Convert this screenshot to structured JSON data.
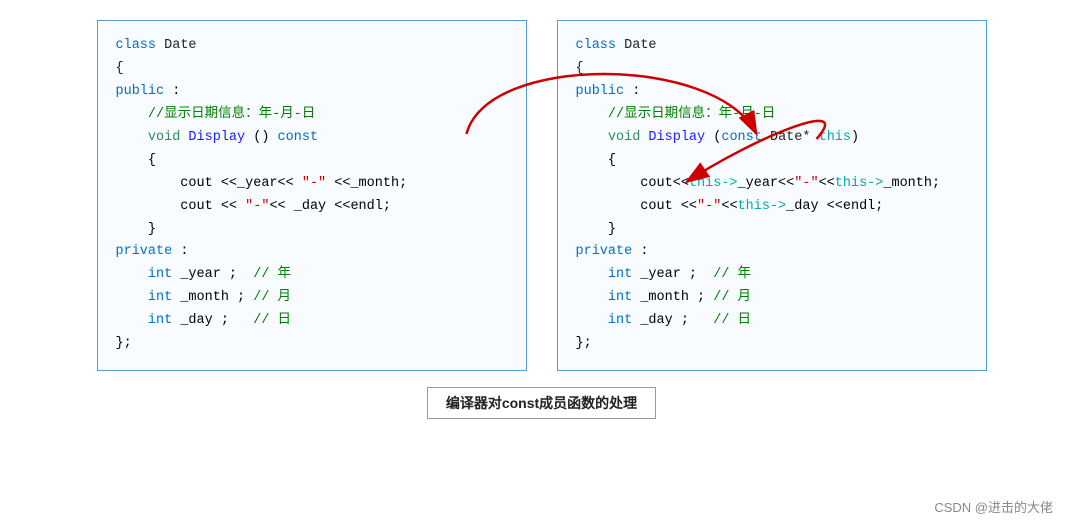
{
  "left_panel": {
    "lines": [
      {
        "id": "l1",
        "content": "class Date",
        "type": "normal"
      },
      {
        "id": "l2",
        "content": "{",
        "type": "normal"
      },
      {
        "id": "l3",
        "content": "public :",
        "type": "keyword_blue"
      },
      {
        "id": "l4",
        "content": "    //显示日期信息：年-月-日",
        "type": "comment"
      },
      {
        "id": "l5",
        "content": "    void Display () const",
        "type": "function"
      },
      {
        "id": "l6",
        "content": "    {",
        "type": "normal"
      },
      {
        "id": "l7",
        "content": "        cout <<_year<< \"-\" <<_month;",
        "type": "normal"
      },
      {
        "id": "l8",
        "content": "        cout << \"-\"<< _day <<endl;",
        "type": "normal"
      },
      {
        "id": "l9",
        "content": "    }",
        "type": "normal"
      },
      {
        "id": "l10",
        "content": "private :",
        "type": "keyword_blue"
      },
      {
        "id": "l11",
        "content": "    int _year ;  // 年",
        "type": "mixed"
      },
      {
        "id": "l12",
        "content": "    int _month ; // 月",
        "type": "mixed"
      },
      {
        "id": "l13",
        "content": "    int _day ;   // 日",
        "type": "mixed"
      },
      {
        "id": "l14",
        "content": "};",
        "type": "normal"
      }
    ]
  },
  "right_panel": {
    "lines": [
      {
        "id": "r1",
        "content": "class Date",
        "type": "normal"
      },
      {
        "id": "r2",
        "content": "{",
        "type": "normal"
      },
      {
        "id": "r3",
        "content": "public :",
        "type": "keyword_blue"
      },
      {
        "id": "r4",
        "content": "    //显示日期信息：年-月-日",
        "type": "comment"
      },
      {
        "id": "r5",
        "content": "    void Display (const Date* this)",
        "type": "function_with_param"
      },
      {
        "id": "r6",
        "content": "    {",
        "type": "normal"
      },
      {
        "id": "r7",
        "content": "        cout<<this->_year<<\"-\"<<this->_month;",
        "type": "normal"
      },
      {
        "id": "r8",
        "content": "        cout <<\"-\"<<this->_day <<endl;",
        "type": "normal"
      },
      {
        "id": "r9",
        "content": "    }",
        "type": "normal"
      },
      {
        "id": "r10",
        "content": "private :",
        "type": "keyword_blue"
      },
      {
        "id": "r11",
        "content": "    int _year ;  // 年",
        "type": "mixed"
      },
      {
        "id": "r12",
        "content": "    int _month ; // 月",
        "type": "mixed"
      },
      {
        "id": "r13",
        "content": "    int _day ;   // 日",
        "type": "mixed"
      },
      {
        "id": "r14",
        "content": "};",
        "type": "normal"
      }
    ]
  },
  "caption": "编译器对const成员函数的处理",
  "csdn_label": "CSDN @进击的大佬"
}
